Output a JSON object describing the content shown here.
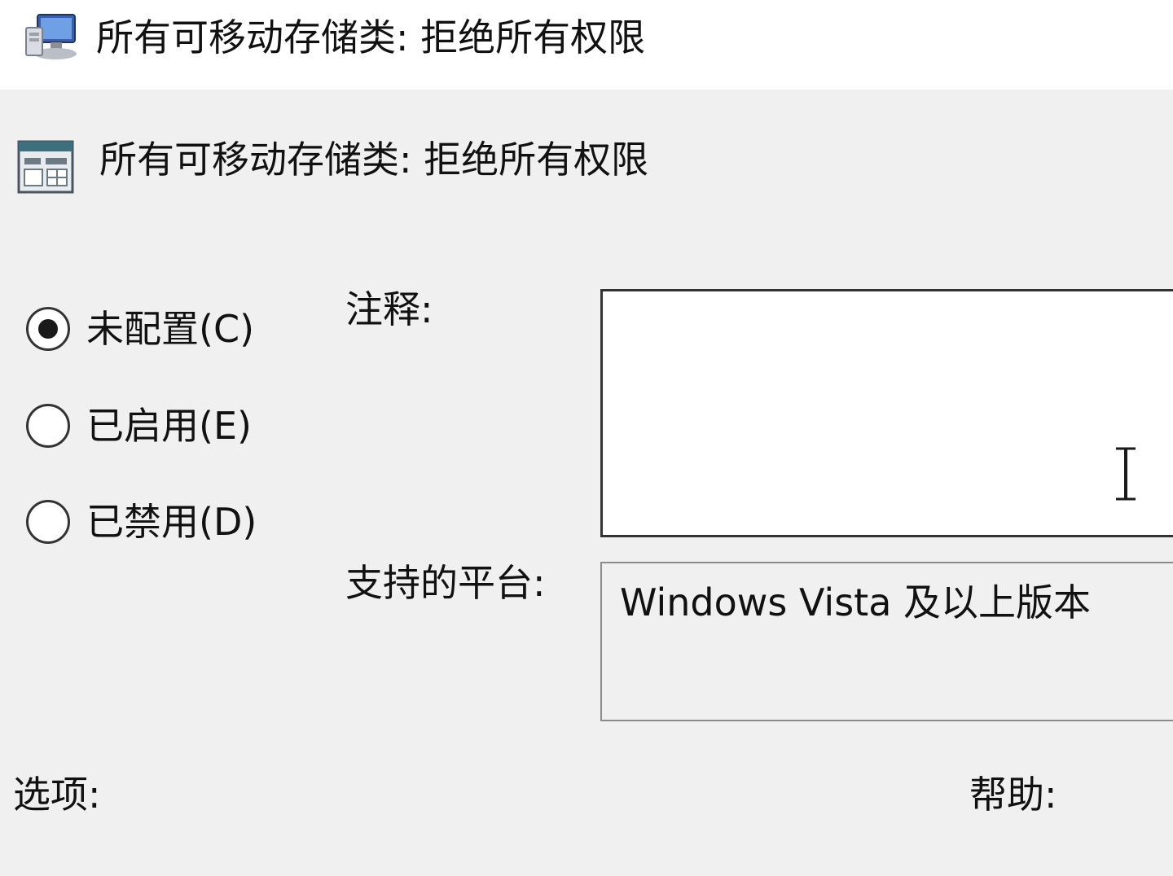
{
  "window": {
    "title": "所有可移动存储类: 拒绝所有权限",
    "title_icon": "group-policy-computer-icon"
  },
  "header": {
    "title": "所有可移动存储类: 拒绝所有权限",
    "icon": "policy-setting-icon"
  },
  "state_options": [
    {
      "label": "未配置(C)",
      "checked": true
    },
    {
      "label": "已启用(E)",
      "checked": false
    },
    {
      "label": "已禁用(D)",
      "checked": false
    }
  ],
  "comment": {
    "label": "注释:",
    "value": ""
  },
  "platform": {
    "label": "支持的平台:",
    "value": "Windows Vista 及以上版本"
  },
  "sections": {
    "options_label": "选项:",
    "help_label": "帮助:"
  }
}
